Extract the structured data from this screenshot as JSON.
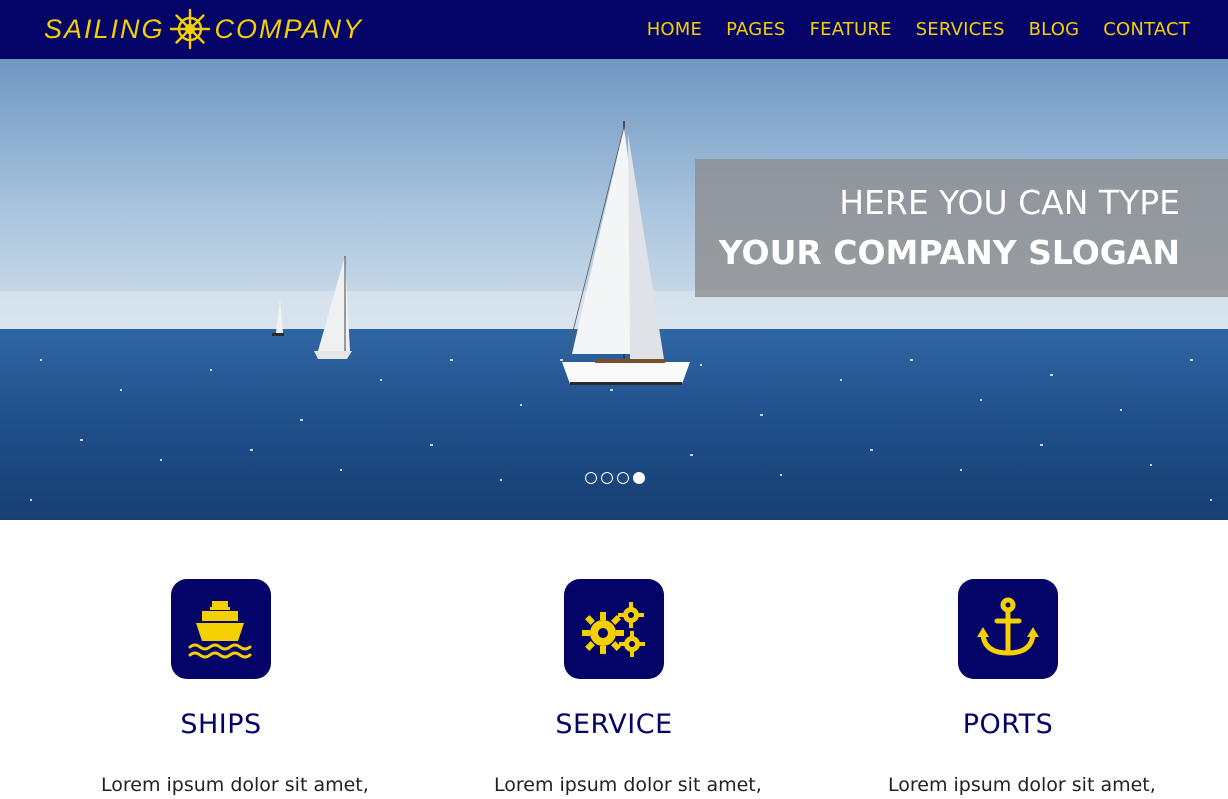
{
  "brand": {
    "left": "SAILING",
    "right": "COMPANY",
    "icon": "ship-wheel-icon",
    "color_bg": "#030368",
    "color_accent": "#f5d000"
  },
  "nav": {
    "items": [
      {
        "label": "HOME"
      },
      {
        "label": "PAGES"
      },
      {
        "label": "FEATURE"
      },
      {
        "label": "SERVICES"
      },
      {
        "label": "BLOG"
      },
      {
        "label": "CONTACT"
      }
    ]
  },
  "hero": {
    "line1": "HERE YOU CAN TYPE",
    "line2": "YOUR COMPANY SLOGAN",
    "slides": 4,
    "active_slide": 4
  },
  "features": [
    {
      "icon": "ship-icon",
      "title": "SHIPS",
      "text": "Lorem ipsum dolor sit amet,"
    },
    {
      "icon": "gears-icon",
      "title": "SERVICE",
      "text": "Lorem ipsum dolor sit amet,"
    },
    {
      "icon": "anchor-icon",
      "title": "PORTS",
      "text": "Lorem ipsum dolor sit amet,"
    }
  ]
}
